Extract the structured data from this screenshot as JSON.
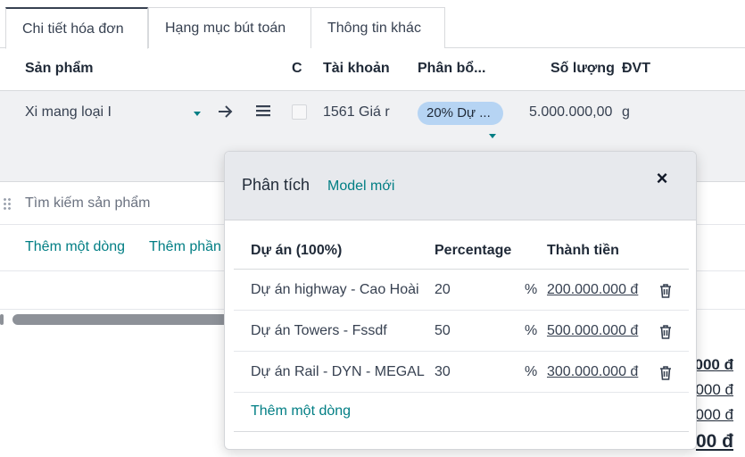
{
  "tabs": [
    {
      "label": "Chi tiết hóa đơn",
      "active": true
    },
    {
      "label": "Hạng mục bút toán",
      "active": false
    },
    {
      "label": "Thông tin khác",
      "active": false
    }
  ],
  "columns": {
    "product": "Sản phẩm",
    "c": "C",
    "account": "Tài khoản",
    "distribution": "Phân bổ...",
    "quantity": "Số lượng",
    "uom": "ĐVT"
  },
  "line": {
    "product": "Xi mang loại I",
    "account": "1561 Giá r",
    "distribution_badge": "20% Dự ...",
    "quantity": "5.000.000,00",
    "uom": "g"
  },
  "search": {
    "placeholder": "Tìm kiếm sản phẩm"
  },
  "actions": {
    "add_line": "Thêm một dòng",
    "add_section": "Thêm phần"
  },
  "totals": [
    "000 đ",
    "000 đ",
    "000 đ",
    "00 đ"
  ],
  "popup": {
    "title": "Phân tích",
    "model_link": "Model mới",
    "close_symbol": "×",
    "headers": {
      "project": "Dự án (100%)",
      "percentage": "Percentage",
      "amount": "Thành tiền"
    },
    "rows": [
      {
        "project": "Dự án highway - Cao Hoài",
        "percentage": "20",
        "unit": "%",
        "amount": "200.000.000 đ"
      },
      {
        "project": "Dự án Towers - Fssdf",
        "percentage": "50",
        "unit": "%",
        "amount": "500.000.000 đ"
      },
      {
        "project": "Dự án Rail - DYN - MEGAL",
        "percentage": "30",
        "unit": "%",
        "amount": "300.000.000 đ"
      }
    ],
    "add_line": "Thêm một dòng"
  },
  "colors": {
    "accent": "#017e84",
    "badge": "#b6d4f3",
    "header_bg": "#e7e9ed",
    "selected_row": "#f0f1f3"
  }
}
